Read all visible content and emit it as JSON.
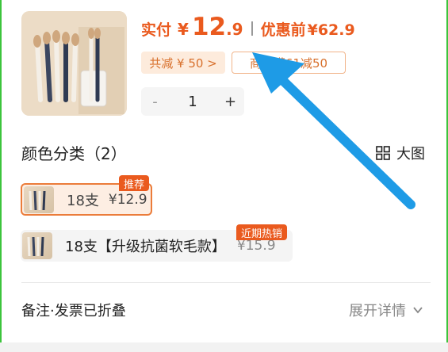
{
  "price": {
    "label": "实付",
    "currency": "¥",
    "integer": "12",
    "decimal": ".9",
    "orig_label": "优惠前",
    "orig_price": "¥62.9"
  },
  "tags": {
    "discount": "共减 ¥ 50 >",
    "shop": "商品满61减50"
  },
  "quantity": {
    "minus": "-",
    "value": "1",
    "plus": "+"
  },
  "section": {
    "title": "颜色分类（2）",
    "view_toggle": "大图"
  },
  "variants": [
    {
      "name": "18支",
      "price": "¥12.9",
      "badge": "推荐",
      "selected": true
    },
    {
      "name": "18支【升级抗菌软毛款】",
      "price": "¥15.9",
      "badge": "近期热销",
      "selected": false
    }
  ],
  "footer": {
    "notes": "备注·发票已折叠",
    "expand": "展开详情"
  },
  "colors": {
    "accent": "#ea5a1e",
    "arrow": "#1e9be6",
    "frame": "#3cc43c"
  },
  "icons": [
    "grid-icon",
    "chevron-down-icon",
    "annotation-arrow"
  ]
}
